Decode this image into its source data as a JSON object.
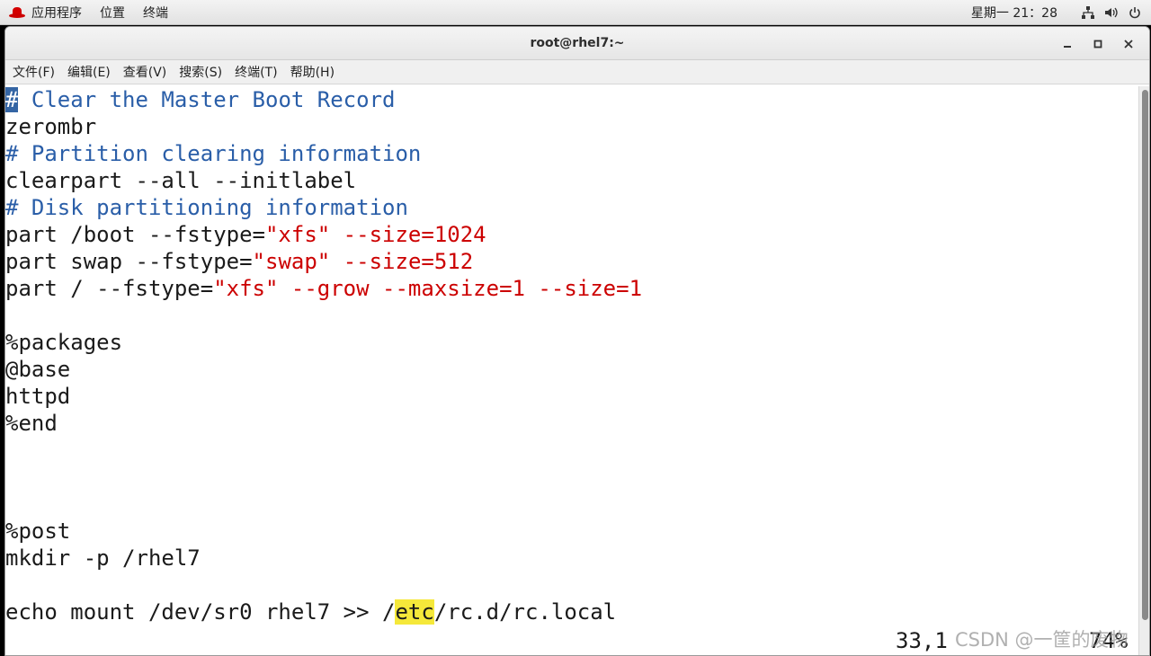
{
  "panel": {
    "apps": "应用程序",
    "places": "位置",
    "terminal": "终端",
    "clock": "星期一 21：28"
  },
  "window": {
    "title": "root@rhel7:~",
    "minimize": "‒",
    "maximize": "▫",
    "close": "✕"
  },
  "menubar": {
    "file": "文件(F)",
    "edit": "编辑(E)",
    "view": "查看(V)",
    "search": "搜索(S)",
    "terminal": "终端(T)",
    "help": "帮助(H)"
  },
  "editor": {
    "l1_cursor": "#",
    "l1_rest": " Clear the Master Boot Record",
    "l2": "zerombr",
    "l3": "# Partition clearing information",
    "l4": "clearpart --all --initlabel",
    "l5": "# Disk partitioning information",
    "l6_a": "part /boot --fstype=",
    "l6_b": "\"xfs\" --size=1024",
    "l7_a": "part swap --fstype=",
    "l7_b": "\"swap\" --size=512",
    "l8_a": "part / --fstype=",
    "l8_b": "\"xfs\" --grow --maxsize=1 --size=1",
    "l10": "%packages",
    "l11": "@base",
    "l12": "httpd",
    "l13": "%end",
    "l17": "%post",
    "l18": "mkdir -p /rhel7",
    "l20_a": "echo mount /dev/sr0 rhel7 >> /",
    "l20_hl": "etc",
    "l20_b": "/rc.d/rc.local",
    "status_pos": "33,1",
    "status_pct": "74%"
  },
  "watermark": "CSDN @一筐的废物"
}
